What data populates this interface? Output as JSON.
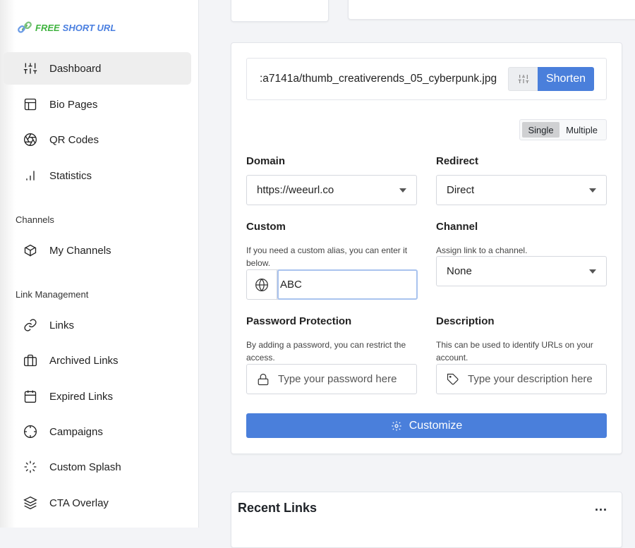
{
  "logo": {
    "word1": "FREE",
    "word2": "SHORT URL"
  },
  "sidebar": {
    "items": [
      {
        "label": "Dashboard",
        "icon": "sliders-icon"
      },
      {
        "label": "Bio Pages",
        "icon": "layout-icon"
      },
      {
        "label": "QR Codes",
        "icon": "aperture-icon"
      },
      {
        "label": "Statistics",
        "icon": "bar-chart-icon"
      }
    ],
    "channels_heading": "Channels",
    "channels": [
      {
        "label": "My Channels",
        "icon": "box-icon"
      }
    ],
    "link_heading": "Link Management",
    "links": [
      {
        "label": "Links",
        "icon": "link-icon"
      },
      {
        "label": "Archived Links",
        "icon": "briefcase-icon"
      },
      {
        "label": "Expired Links",
        "icon": "calendar-icon"
      },
      {
        "label": "Campaigns",
        "icon": "crosshair-icon"
      },
      {
        "label": "Custom Splash",
        "icon": "loader-icon"
      },
      {
        "label": "CTA Overlay",
        "icon": "layers-icon"
      }
    ]
  },
  "form": {
    "url_value": ":a7141a/thumb_creativerends_05_cyberpunk.jpg",
    "shorten": "Shorten",
    "mode": {
      "single": "Single",
      "multiple": "Multiple",
      "selected": "Single"
    },
    "domain": {
      "label": "Domain",
      "value": "https://weeurl.co"
    },
    "redirect": {
      "label": "Redirect",
      "value": "Direct"
    },
    "custom": {
      "label": "Custom",
      "help": "If you need a custom alias, you can enter it below.",
      "value": "ABC"
    },
    "channel": {
      "label": "Channel",
      "help": "Assign link to a channel.",
      "value": "None"
    },
    "password": {
      "label": "Password Protection",
      "help": "By adding a password, you can restrict the access.",
      "placeholder": "Type your password here"
    },
    "description": {
      "label": "Description",
      "help": "This can be used to identify URLs on your account.",
      "placeholder": "Type your description here"
    },
    "customize": "Customize"
  },
  "recent": {
    "title": "Recent Links",
    "menu": "..."
  },
  "colors": {
    "accent": "#4a7fdb",
    "background": "#f3f4f7"
  }
}
